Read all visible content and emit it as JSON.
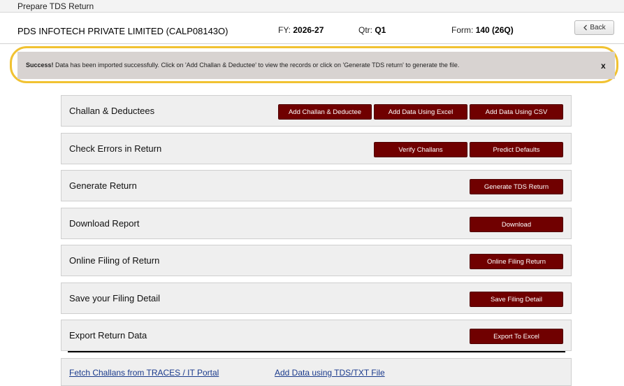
{
  "window": {
    "title": "Prepare TDS Return"
  },
  "header": {
    "company": "PDS INFOTECH PRIVATE LIMITED (CALP08143O)",
    "fy_label": "FY:",
    "fy_value": "2026-27",
    "qtr_label": "Qtr:",
    "qtr_value": "Q1",
    "form_label": "Form:",
    "form_value": "140 (26Q)",
    "back_label": "Back"
  },
  "alert": {
    "strong": "Success!",
    "text": "Data has been imported successfully. Click on 'Add Challan & Deductee' to view the records or click on 'Generate TDS return' to generate the file.",
    "close": "x"
  },
  "sections": [
    {
      "title": "Challan & Deductees",
      "buttons": [
        "Add Challan & Deductee",
        "Add Data Using Excel",
        "Add Data Using CSV"
      ]
    },
    {
      "title": "Check Errors in Return",
      "buttons": [
        "Verify Challans",
        "Predict Defaults"
      ]
    },
    {
      "title": "Generate Return",
      "buttons": [
        "Generate TDS Return"
      ]
    },
    {
      "title": "Download Report",
      "buttons": [
        "Download"
      ]
    },
    {
      "title": "Online Filing of Return",
      "buttons": [
        "Online Filing Return"
      ]
    },
    {
      "title": "Save your Filing Detail",
      "buttons": [
        "Save Filing Detail"
      ]
    },
    {
      "title": "Export Return Data",
      "buttons": [
        "Export To Excel"
      ]
    }
  ],
  "links": {
    "fetch": "Fetch Challans from TRACES / IT Portal",
    "add_txt": "Add Data using TDS/TXT File"
  },
  "colors": {
    "button": "#700000",
    "alert_bg": "#d8d3d1",
    "highlight": "#f1c232",
    "panel_bg": "#efefef"
  }
}
